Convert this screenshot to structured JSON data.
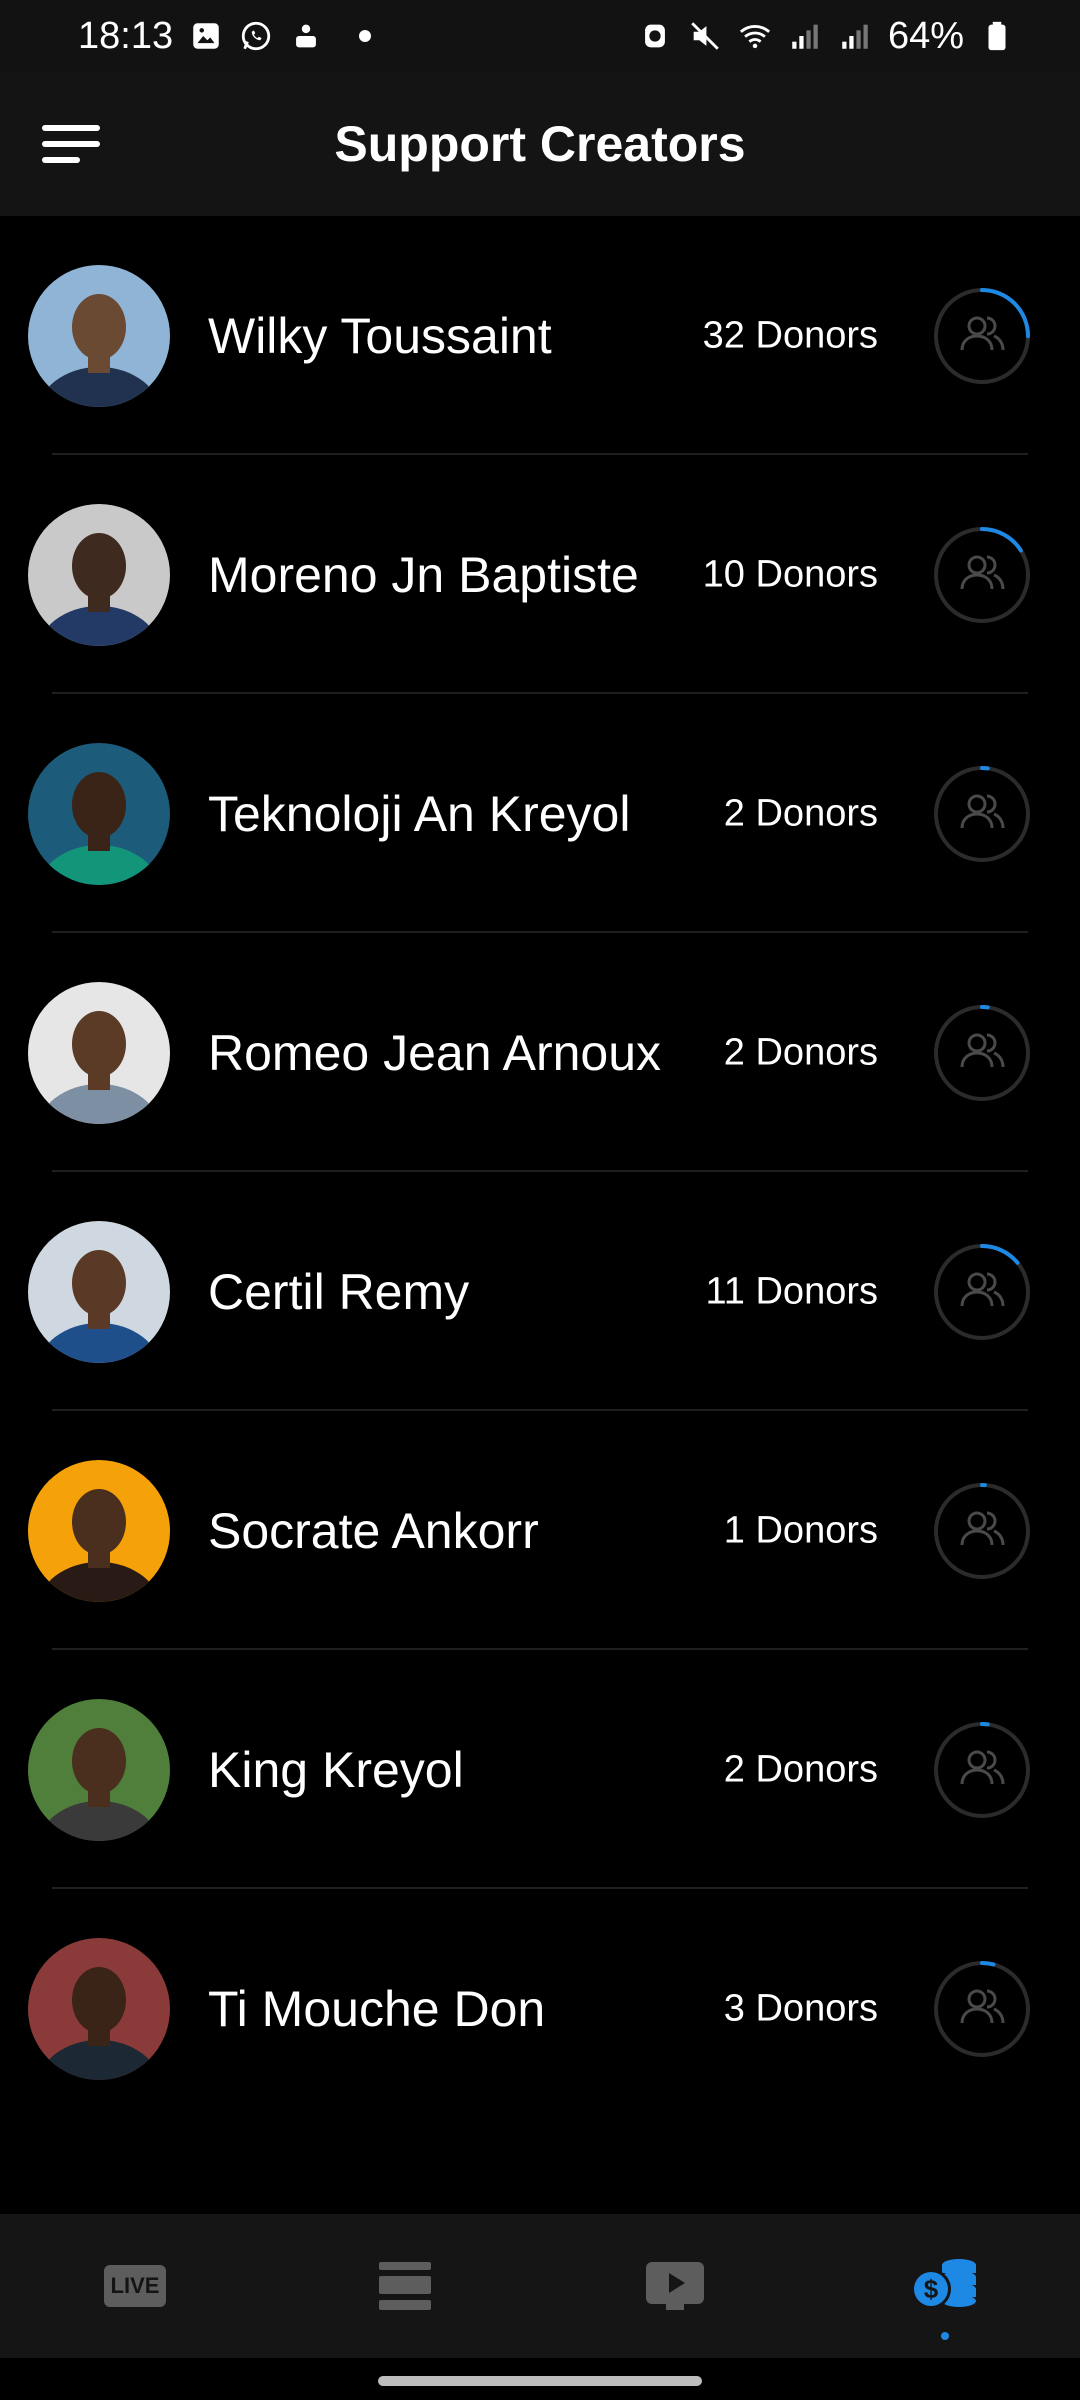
{
  "status_bar": {
    "time": "18:13",
    "battery": "64%",
    "icons": [
      "gallery-icon",
      "whatsapp-icon",
      "news-app-icon",
      "notification-dot",
      "alarm-icon",
      "mute-icon",
      "wifi-icon",
      "signal-icon",
      "signal-icon",
      "battery-icon"
    ]
  },
  "header": {
    "title": "Support Creators",
    "menu_icon": "hamburger-menu-icon"
  },
  "creators": [
    {
      "name": "Wilky Toussaint",
      "donors": "32 Donors",
      "progress": 0.25,
      "skin": "#6b4a33",
      "bg": "#8fb4d6",
      "shirt": "#203250"
    },
    {
      "name": "Moreno Jn Baptiste",
      "donors": "10 Donors",
      "progress": 0.16,
      "skin": "#3f2a1f",
      "bg": "#c9c9c9",
      "shirt": "#233a66"
    },
    {
      "name": "Teknoloji An Kreyol",
      "donors": "2 Donors",
      "progress": 0.02,
      "skin": "#3a2418",
      "bg": "#1d5b7a",
      "shirt": "#13957a"
    },
    {
      "name": "Romeo Jean Arnoux",
      "donors": "2 Donors",
      "progress": 0.02,
      "skin": "#5b3b26",
      "bg": "#e6e6e6",
      "shirt": "#7d8fa3"
    },
    {
      "name": "Certil Remy",
      "donors": "11 Donors",
      "progress": 0.14,
      "skin": "#5a3a26",
      "bg": "#cfd8e0",
      "shirt": "#1f4f8b"
    },
    {
      "name": "Socrate Ankorr",
      "donors": "1 Donors",
      "progress": 0.01,
      "skin": "#4a2f1f",
      "bg": "#f5a10a",
      "shirt": "#2a1a16"
    },
    {
      "name": "King Kreyol",
      "donors": "2 Donors",
      "progress": 0.02,
      "skin": "#4a2e1e",
      "bg": "#4f7f3a",
      "shirt": "#3a3a3a"
    },
    {
      "name": "Ti Mouche Don",
      "donors": "3 Donors",
      "progress": 0.04,
      "skin": "#3a2418",
      "bg": "#8b3a3a",
      "shirt": "#1c2833"
    }
  ],
  "bottom_nav": {
    "items": [
      {
        "label": "LIVE",
        "icon": "live-icon",
        "active": false
      },
      {
        "label": "",
        "icon": "list-icon",
        "active": false
      },
      {
        "label": "",
        "icon": "video-icon",
        "active": false
      },
      {
        "label": "",
        "icon": "donate-coins-icon",
        "active": true
      }
    ]
  },
  "colors": {
    "accent": "#1e88e5",
    "background": "#000000",
    "app_bar": "#141414",
    "ring": "#2b2b2b",
    "inactive_icon": "#5d5d5d"
  }
}
